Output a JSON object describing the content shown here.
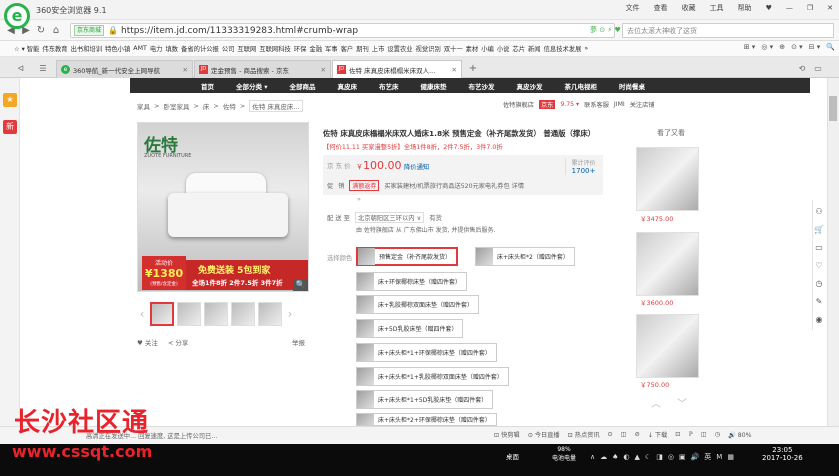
{
  "window": {
    "title": "360安全浏览器 9.1",
    "menu": [
      "文件",
      "查看",
      "收藏",
      "工具",
      "帮助"
    ],
    "controls": [
      "♥",
      "—",
      "❐",
      "✕"
    ]
  },
  "nav": {
    "back": "◀",
    "forward": "▶",
    "refresh": "↻",
    "home": "⌂",
    "site_tag": "京东商城",
    "url": "https://item.jd.com/11333319283.html#crumb-wrap",
    "tools": "夢 ⊙ ⚡ ♥",
    "search_placeholder": "去位太滚大神收了这货"
  },
  "bookmarks": {
    "items": [
      "☆ ▾ 智能",
      "伟东教育",
      "出书和培训",
      "特色小镇",
      "AMT",
      "电力",
      "填数",
      "备省的计公报",
      "公司",
      "互联网",
      "互联网科技",
      "环保",
      "金融",
      "军事",
      "客户",
      "期刊",
      "上市",
      "设置农业",
      "视觉识别",
      "双十一",
      "素材",
      "小编",
      "小说",
      "芯片",
      "新闻",
      "信息技术发展",
      "»"
    ],
    "right": [
      "⊞ ▾",
      "◎ ▾",
      "⊕",
      "⊙ ▾",
      "⊟ ▾",
      "🔍"
    ]
  },
  "tabs": [
    {
      "label": "360导航_新一代安全上网导航",
      "icon": "e"
    },
    {
      "label": "定金预售 - 商品搜索 - 京东",
      "icon": "JD"
    },
    {
      "label": "佐特 床真皮床榻榻米床双人...",
      "icon": "JD",
      "active": true
    }
  ],
  "tab_new": "+",
  "left_sidebar": [
    "★",
    "新"
  ],
  "right_sidebar": [
    "⚇",
    "🛒",
    "▭",
    "♡",
    "◷",
    "✎",
    "◉"
  ],
  "jd": {
    "categories": [
      "首页",
      "全部分类 ▾",
      "全部商品",
      "真皮床",
      "布艺床",
      "健康床垫",
      "布艺沙发",
      "真皮沙发",
      "茶几电视柜",
      "时尚餐桌"
    ],
    "breadcrumb": [
      "家具",
      ">",
      "卧室家具",
      ">",
      "床",
      ">",
      "佐特",
      ">",
      "佐特 床真皮床..."
    ],
    "shop": {
      "name": "佐特旗舰店",
      "im": "京东",
      "score": "9.75 ▾",
      "contact": "联系客服",
      "jimi": "JIMI",
      "follow": "关注店铺"
    },
    "gallery": {
      "brand": "佐特",
      "brand_sub": "ZUOTE FURNITURE",
      "sticker_label": "活动价",
      "sticker_price": "¥1380",
      "sticker_note": "(预售/含定金)",
      "promo_line1": "免费送装 5包到家",
      "promo_line2": "全场1件8折 2件7.5折 3件7折",
      "zoom": "🔍",
      "thumbs_prev": "‹",
      "thumbs_next": "›",
      "follow": "♥ 关注",
      "share": "≺ 分享",
      "report": "举报"
    },
    "product": {
      "title": "佐特 床真皮床榻榻米床双人婚床1.8米 预售定金（补齐尾款发货） 普通版（撑床）",
      "subtitle": "【何价11.11 买家漫整5折】全场1件8折，2件7.5折，3件7.0折",
      "price_label": "京 东 价",
      "currency": "￥",
      "price": "100.00",
      "price_notice": "降价通知",
      "review_label": "累计评价",
      "review_count": "1700+",
      "promo_label": "促",
      "promo_sub": "销",
      "promo_tag": "满额返券",
      "promo_text": "买家装建材/机票旅行商品送520元家电礼券包  详情",
      "more": "»",
      "delivery_label": "配 送 至",
      "delivery_to": "北京朝阳区三环以内 ∨",
      "stock": "有货",
      "shipping": "由 佐特旗舰店 从 广东佛山市 发货, 并提供售后服务.",
      "shipping_shop": "佐特旗舰店",
      "option_label": "选择颜色"
    },
    "options": [
      {
        "label": "预售定金（补齐尾款发货）",
        "selected": true
      },
      {
        "label": "床+床头柜*2（赠四件套）"
      },
      {
        "label": "床+环保椰棕床垫（赠四件套）"
      },
      {
        "label": "床+乳胶椰棕双面床垫（赠四件套）"
      },
      {
        "label": "床+5D乳胶床垫（赠四件套）"
      },
      {
        "label": "床+床头柜*1+环保椰棕床垫（赠四件套）"
      },
      {
        "label": "床+床头柜*1+乳胶椰棕双面床垫（赠四件套）"
      },
      {
        "label": "床+床头柜*1+5D乳胶床垫（赠四件套）"
      },
      {
        "label": "床+床头柜*2+环保椰棕床垫（赠四件套）"
      }
    ],
    "also_viewed": {
      "label": "看了又看",
      "prices": [
        "￥3475.00",
        "￥3600.00",
        "￥750.00"
      ],
      "up": "︿",
      "down": "﹀"
    }
  },
  "status": {
    "left": "高清正在发送中... 回复速度, 这是上传公司已...",
    "items": [
      "⊡ 快剪辑",
      "⊙ 今日直播",
      "⊡ 热点资讯",
      "⊙",
      "◫",
      "⊘",
      "↓ 下载",
      "⊡",
      "ℙ",
      "◫",
      "◷",
      "🔊 80%"
    ]
  },
  "taskbar": {
    "desktop": "桌面",
    "battery_pct": "98%",
    "battery_label": "电池电量",
    "tray": [
      "∧",
      "☁",
      "♠",
      "◐",
      "▲",
      "☾",
      "◨",
      "◎",
      "▣",
      "🔊",
      "英",
      "M",
      "▦"
    ],
    "time": "23:05",
    "date": "2017-10-26"
  },
  "watermark": {
    "line1": "长沙社区通",
    "line2": "www.cssqt.com"
  },
  "colors": {
    "jd_red": "#e4393c",
    "browser_green": "#27b34a",
    "link_blue": "#005ea7"
  }
}
